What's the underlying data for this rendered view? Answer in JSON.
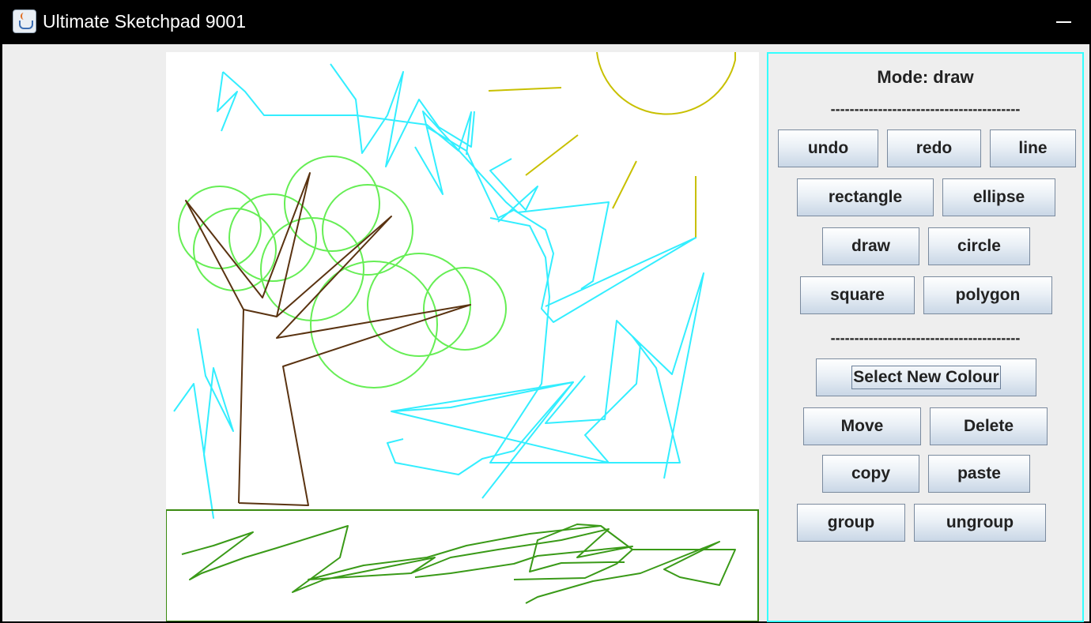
{
  "window": {
    "title": "Ultimate Sketchpad 9001"
  },
  "panel": {
    "mode_label": "Mode: draw",
    "separator": "----------------------------------------",
    "buttons": {
      "undo": "undo",
      "redo": "redo",
      "line": "line",
      "rectangle": "rectangle",
      "ellipse": "ellipse",
      "draw": "draw",
      "circle": "circle",
      "square": "square",
      "polygon": "polygon",
      "select_colour": "Select New Colour",
      "move": "Move",
      "delete": "Delete",
      "copy": "copy",
      "paste": "paste",
      "group": "group",
      "ungroup": "ungroup"
    },
    "border_color": "#33ffff"
  },
  "colors": {
    "cyan": "#33eeff",
    "green_light": "#66ee55",
    "brown": "#5a3311",
    "yellow": "#c8c000",
    "grass": "#3a9a18",
    "ground_border": "#3a8a10"
  }
}
